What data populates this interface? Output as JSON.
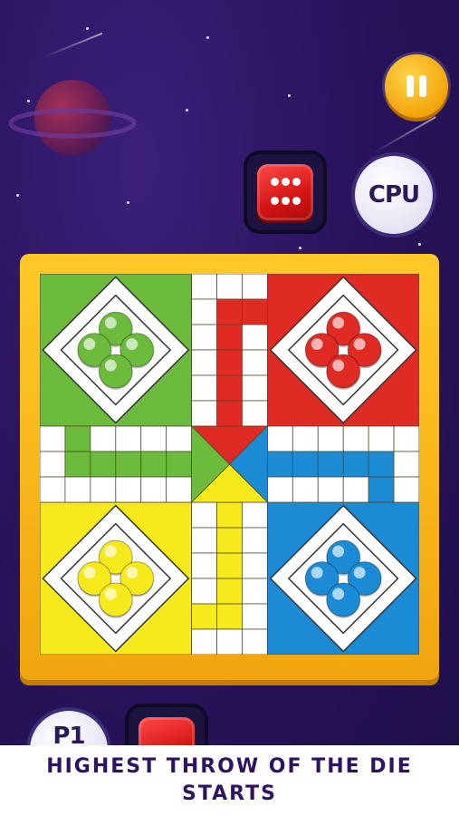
{
  "opponent": {
    "label": "CPU"
  },
  "player": {
    "label": "P1"
  },
  "caption": {
    "text": "HIGHEST THROW OF THE DIE STARTS"
  },
  "dice_top": {
    "value": 6,
    "color": "#e0191b"
  },
  "board": {
    "colors": {
      "green": "#6cbb3c",
      "red": "#e02a24",
      "yellow": "#f7ea1c",
      "blue": "#1b8bd6",
      "frame": "#f3b21a"
    },
    "tokens_per_player": 4
  }
}
